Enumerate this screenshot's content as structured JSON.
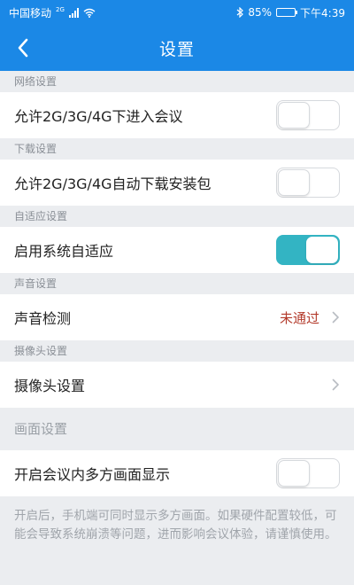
{
  "status_bar": {
    "carrier": "中国移动",
    "network_tag": "2G",
    "battery_percent": "85%",
    "battery_level": 0.85,
    "time": "下午4:39"
  },
  "header": {
    "title": "设置",
    "back_icon": "chevron-left-icon"
  },
  "sections": {
    "network": {
      "header": "网络设置",
      "allow_meeting_label": "允许2G/3G/4G下进入会议",
      "allow_meeting_on": false
    },
    "download": {
      "header": "下载设置",
      "auto_download_label": "允许2G/3G/4G自动下载安装包",
      "auto_download_on": false
    },
    "adaptive": {
      "header": "自适应设置",
      "enable_adaptive_label": "启用系统自适应",
      "enable_adaptive_on": true
    },
    "sound": {
      "header": "声音设置",
      "sound_check_label": "声音检测",
      "sound_check_status": "未通过"
    },
    "camera": {
      "header": "摄像头设置",
      "camera_settings_label": "摄像头设置"
    },
    "screen": {
      "header": "画面设置",
      "multi_screen_label": "开启会议内多方画面显示",
      "multi_screen_on": false,
      "note": "开启后，手机端可同时显示多方画面。如果硬件配置较低，可能会导致系统崩溃等问题，进而影响会议体验，请谨慎使用。"
    }
  },
  "colors": {
    "primary": "#1b88e6",
    "toggle_on": "#33b4c3",
    "status_fail": "#b33a2b",
    "background": "#ebedf0"
  }
}
